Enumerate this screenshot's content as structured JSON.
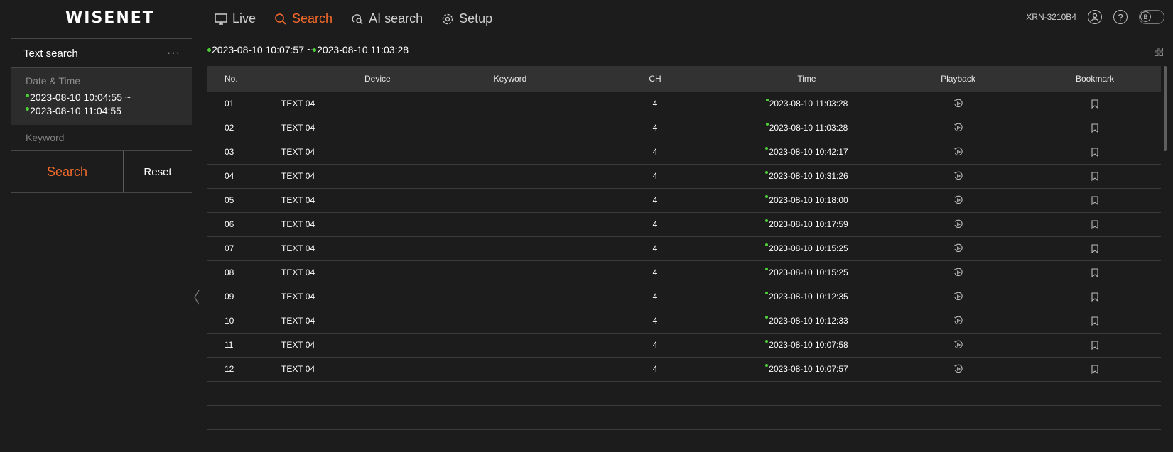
{
  "app": {
    "logo": "WISENET",
    "model": "XRN-3210B4",
    "toggle_label": "B"
  },
  "nav": {
    "live": "Live",
    "search": "Search",
    "ai_search": "AI search",
    "setup": "Setup"
  },
  "sidebar": {
    "title": "Text search",
    "more": "···",
    "date_time_label": "Date & Time",
    "date_from": "2023-08-10 10:04:55 ~",
    "date_to": "2023-08-10 11:04:55",
    "keyword_placeholder": "Keyword",
    "search_button": "Search",
    "reset_button": "Reset"
  },
  "results": {
    "range_start": "2023-08-10 10:07:57 ~ ",
    "range_end": "2023-08-10 11:03:28",
    "columns": [
      "No.",
      "Device",
      "Keyword",
      "CH",
      "Time",
      "Playback",
      "Bookmark"
    ],
    "rows": [
      {
        "no": "01",
        "device": "TEXT 04",
        "keyword": "",
        "ch": "4",
        "time": "2023-08-10 11:03:28"
      },
      {
        "no": "02",
        "device": "TEXT 04",
        "keyword": "",
        "ch": "4",
        "time": "2023-08-10 11:03:28"
      },
      {
        "no": "03",
        "device": "TEXT 04",
        "keyword": "",
        "ch": "4",
        "time": "2023-08-10 10:42:17"
      },
      {
        "no": "04",
        "device": "TEXT 04",
        "keyword": "",
        "ch": "4",
        "time": "2023-08-10 10:31:26"
      },
      {
        "no": "05",
        "device": "TEXT 04",
        "keyword": "",
        "ch": "4",
        "time": "2023-08-10 10:18:00"
      },
      {
        "no": "06",
        "device": "TEXT 04",
        "keyword": "",
        "ch": "4",
        "time": "2023-08-10 10:17:59"
      },
      {
        "no": "07",
        "device": "TEXT 04",
        "keyword": "",
        "ch": "4",
        "time": "2023-08-10 10:15:25"
      },
      {
        "no": "08",
        "device": "TEXT 04",
        "keyword": "",
        "ch": "4",
        "time": "2023-08-10 10:15:25"
      },
      {
        "no": "09",
        "device": "TEXT 04",
        "keyword": "",
        "ch": "4",
        "time": "2023-08-10 10:12:35"
      },
      {
        "no": "10",
        "device": "TEXT 04",
        "keyword": "",
        "ch": "4",
        "time": "2023-08-10 10:12:33"
      },
      {
        "no": "11",
        "device": "TEXT 04",
        "keyword": "",
        "ch": "4",
        "time": "2023-08-10 10:07:58"
      },
      {
        "no": "12",
        "device": "TEXT 04",
        "keyword": "",
        "ch": "4",
        "time": "2023-08-10 10:07:57"
      }
    ]
  },
  "colors": {
    "accent": "#f26a2b",
    "dot": "#4cd137",
    "background": "#1c1c1c"
  },
  "icons": [
    "monitor-icon",
    "search-icon",
    "ai-search-icon",
    "gear-icon",
    "user-icon",
    "help-icon",
    "grid-view-icon",
    "playback-icon",
    "bookmark-icon",
    "chevron-left-icon"
  ]
}
